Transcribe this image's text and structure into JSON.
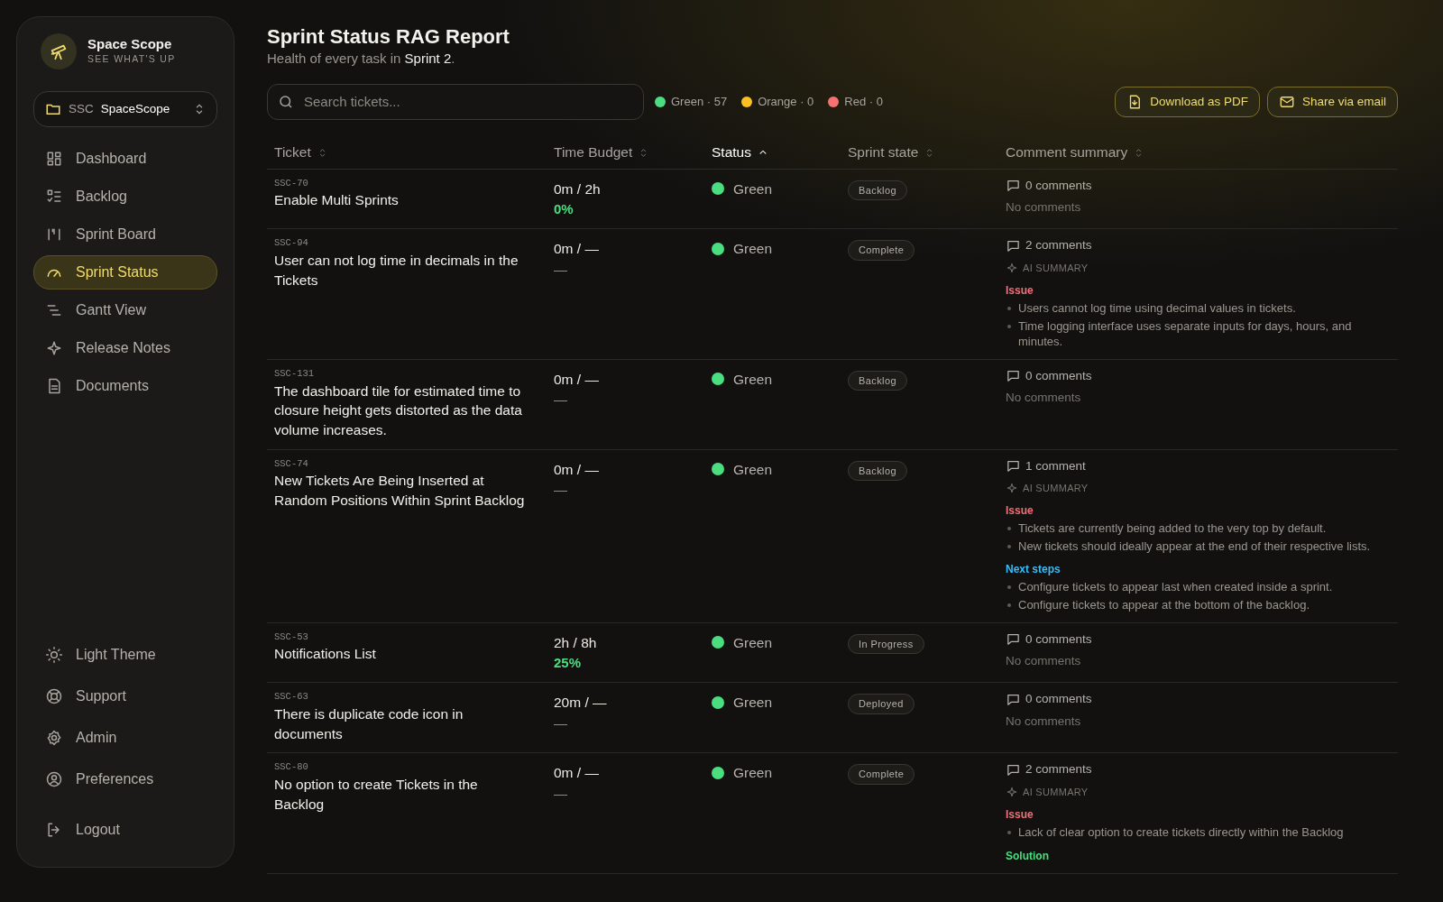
{
  "brand": {
    "name": "Space Scope",
    "tagline": "SEE WHAT'S UP"
  },
  "project": {
    "code": "SSC",
    "name": "SpaceScope"
  },
  "nav": [
    {
      "label": "Dashboard",
      "selected": false
    },
    {
      "label": "Backlog",
      "selected": false
    },
    {
      "label": "Sprint Board",
      "selected": false
    },
    {
      "label": "Sprint Status",
      "selected": true
    },
    {
      "label": "Gantt View",
      "selected": false
    },
    {
      "label": "Release Notes",
      "selected": false
    },
    {
      "label": "Documents",
      "selected": false
    }
  ],
  "footer_nav": [
    {
      "label": "Light Theme"
    },
    {
      "label": "Support"
    },
    {
      "label": "Admin"
    },
    {
      "label": "Preferences"
    },
    {
      "label": "Logout"
    }
  ],
  "header": {
    "title": "Sprint Status RAG Report",
    "subtitle": "Health of every task in **Sprint 2**."
  },
  "search": {
    "placeholder": "Search tickets..."
  },
  "legend": [
    {
      "label": "Green · 57",
      "color": "#4ade80"
    },
    {
      "label": "Orange · 0",
      "color": "#fbbf24"
    },
    {
      "label": "Red · 0",
      "color": "#f87171"
    }
  ],
  "buttons": [
    {
      "label": "Download as PDF"
    },
    {
      "label": "Share via email"
    }
  ],
  "table": {
    "columns": [
      {
        "label": "Ticket",
        "sorted": false
      },
      {
        "label": "Time Budget",
        "sorted": false
      },
      {
        "label": "Status",
        "sorted": true
      },
      {
        "label": "Sprint state",
        "sorted": false
      },
      {
        "label": "Comment summary",
        "sorted": false
      }
    ],
    "rows": [
      {
        "id": "SSC-70",
        "title": "Enable Multi Sprints",
        "time": "0m / 2h",
        "progress": {
          "kind": "percent",
          "text": "0%"
        },
        "status": {
          "label": "Green",
          "color": "#4ade80"
        },
        "state": "Backlog",
        "comments": "0 comments",
        "note": "No comments"
      },
      {
        "id": "SSC-94",
        "title": "User can not log time in decimals in the Tickets",
        "time": "0m / —",
        "progress": {
          "kind": "none",
          "text": "—"
        },
        "status": {
          "label": "Green",
          "color": "#4ade80"
        },
        "state": "Complete",
        "comments": "2 comments",
        "ai_label": "AI SUMMARY",
        "sections": [
          {
            "kind": "issue",
            "heading": "Issue",
            "points": [
              "Users cannot log time using decimal values in tickets.",
              "Time logging interface uses separate inputs for days, hours, and minutes."
            ]
          }
        ]
      },
      {
        "id": "SSC-131",
        "title": "The dashboard tile for estimated time to closure height gets distorted as the data volume increases.",
        "time": "0m / —",
        "progress": {
          "kind": "none",
          "text": "—"
        },
        "status": {
          "label": "Green",
          "color": "#4ade80"
        },
        "state": "Backlog",
        "comments": "0 comments",
        "note": "No comments"
      },
      {
        "id": "SSC-74",
        "title": "New Tickets Are Being Inserted at Random Positions Within Sprint Backlog",
        "time": "0m / —",
        "progress": {
          "kind": "none",
          "text": "—"
        },
        "status": {
          "label": "Green",
          "color": "#4ade80"
        },
        "state": "Backlog",
        "comments": "1 comment",
        "ai_label": "AI SUMMARY",
        "sections": [
          {
            "kind": "issue",
            "heading": "Issue",
            "points": [
              "Tickets are currently being added to the very top by default.",
              "New tickets should ideally appear at the end of their respective lists."
            ]
          },
          {
            "kind": "next",
            "heading": "Next steps",
            "points": [
              "Configure tickets to appear last when created inside a sprint.",
              "Configure tickets to appear at the bottom of the backlog."
            ]
          }
        ]
      },
      {
        "id": "SSC-53",
        "title": "Notifications List",
        "time": "2h / 8h",
        "progress": {
          "kind": "percent",
          "text": "25%"
        },
        "status": {
          "label": "Green",
          "color": "#4ade80"
        },
        "state": "In Progress",
        "comments": "0 comments",
        "note": "No comments"
      },
      {
        "id": "SSC-63",
        "title": "There is duplicate code icon in documents",
        "time": "20m / —",
        "progress": {
          "kind": "none",
          "text": "—"
        },
        "status": {
          "label": "Green",
          "color": "#4ade80"
        },
        "state": "Deployed",
        "comments": "0 comments",
        "note": "No comments"
      },
      {
        "id": "SSC-80",
        "title": "No option to create Tickets in the Backlog",
        "time": "0m / —",
        "progress": {
          "kind": "none",
          "text": "—"
        },
        "status": {
          "label": "Green",
          "color": "#4ade80"
        },
        "state": "Complete",
        "comments": "2 comments",
        "ai_label": "AI SUMMARY",
        "sections": [
          {
            "kind": "issue",
            "heading": "Issue",
            "points": [
              "Lack of clear option to create tickets directly within the Backlog"
            ]
          },
          {
            "kind": "solution",
            "heading": "Solution"
          }
        ]
      }
    ]
  }
}
